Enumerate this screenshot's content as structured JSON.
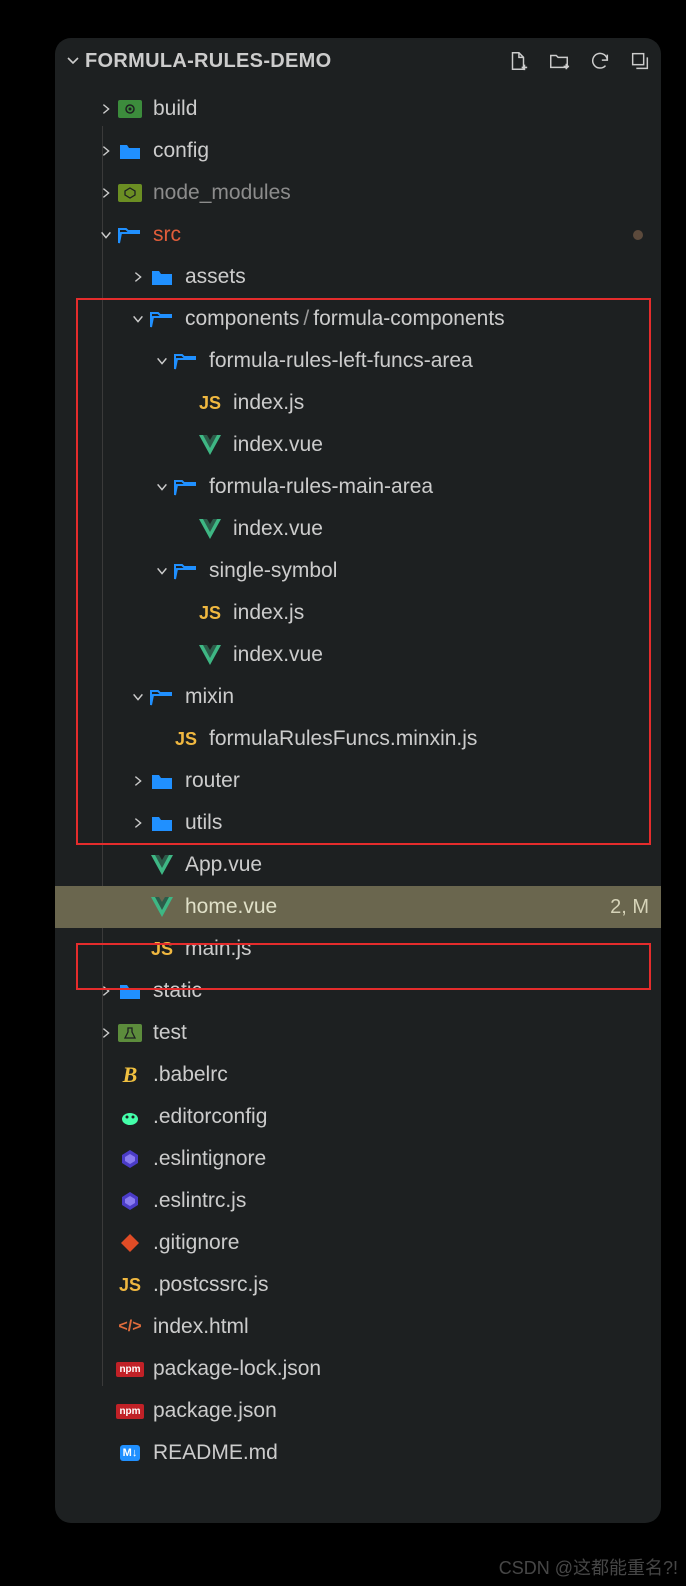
{
  "header": {
    "title": "FORMULA-RULES-DEMO"
  },
  "tree": {
    "build": "build",
    "config": "config",
    "node_modules": "node_modules",
    "src": "src",
    "assets": "assets",
    "components": "components",
    "formula_components": "formula-components",
    "frlfa": "formula-rules-left-funcs-area",
    "index_js": "index.js",
    "index_vue": "index.vue",
    "frma": "formula-rules-main-area",
    "single_symbol": "single-symbol",
    "mixin": "mixin",
    "mixin_file": "formulaRulesFuncs.minxin.js",
    "router": "router",
    "utils": "utils",
    "app_vue": "App.vue",
    "home_vue": "home.vue",
    "home_status": "2, M",
    "main_js": "main.js",
    "static": "static",
    "test": "test",
    "babelrc": ".babelrc",
    "editorconfig": ".editorconfig",
    "eslintignore": ".eslintignore",
    "eslintrc": ".eslintrc.js",
    "gitignore": ".gitignore",
    "postcssrc": ".postcssrc.js",
    "index_html": "index.html",
    "pkg_lock": "package-lock.json",
    "pkg": "package.json",
    "readme": "README.md"
  },
  "slash": "/",
  "watermark": "CSDN @这都能重名?!"
}
